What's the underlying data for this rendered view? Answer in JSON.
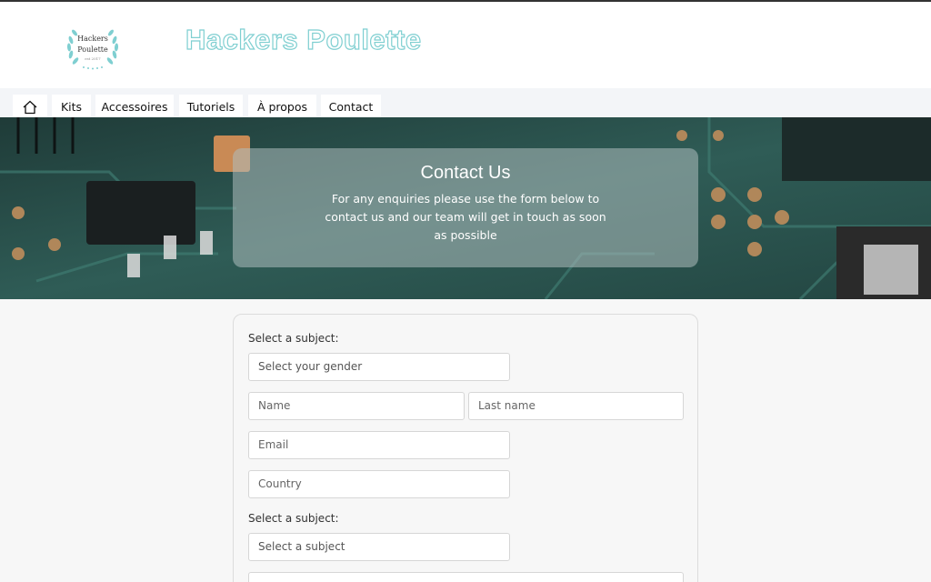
{
  "header": {
    "logo": {
      "line1": "Hackers",
      "line2": "Poulette",
      "line3": "est 2017"
    },
    "site_title": "Hackers Poulette"
  },
  "nav": {
    "items": [
      {
        "icon": "home-icon"
      },
      {
        "label": "Kits"
      },
      {
        "label": "Accessoires"
      },
      {
        "label": "Tutoriels"
      },
      {
        "label": "À propos"
      },
      {
        "label": "Contact"
      }
    ]
  },
  "hero": {
    "title": "Contact Us",
    "text": "For any enquiries please use the form below to contact us and our team will get in touch as soon as possible"
  },
  "form": {
    "gender_label": "Select a subject:",
    "gender_select": "Select your gender",
    "name_placeholder": "Name",
    "lastname_placeholder": "Last name",
    "email_placeholder": "Email",
    "country_placeholder": "Country",
    "subject_label": "Select a subject:",
    "subject_select": "Select a subject"
  },
  "colors": {
    "title_outline": "#7fcfd1",
    "nav_bg": "#f3f5f8",
    "page_bg": "#f7f7f7",
    "hero_overlay": "#afbebe"
  }
}
